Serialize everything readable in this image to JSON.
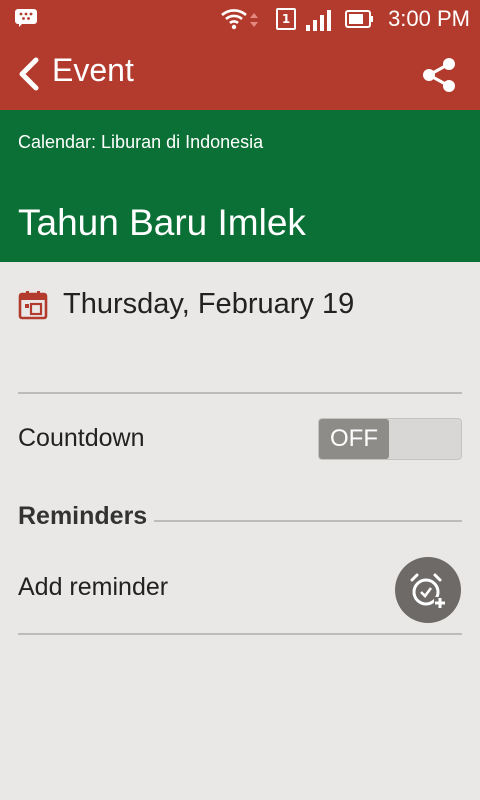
{
  "status_bar": {
    "time": "3:00 PM",
    "sim_slot": "1",
    "icons": [
      "bbm-icon",
      "wifi-icon",
      "sim-icon",
      "signal-icon",
      "battery-icon"
    ]
  },
  "app_bar": {
    "title": "Event",
    "icons": [
      "back-arrow-icon",
      "share-icon"
    ]
  },
  "event": {
    "calendar_label": "Calendar: Liburan di Indonesia",
    "title": "Tahun Baru Imlek",
    "date": "Thursday, February 19"
  },
  "countdown": {
    "label": "Countdown",
    "toggle_text": "OFF",
    "enabled": false
  },
  "reminders": {
    "section_title": "Reminders",
    "add_label": "Add reminder"
  },
  "colors": {
    "app_bar": "#b33b2d",
    "header": "#0a7035",
    "background": "#e9e8e6"
  }
}
